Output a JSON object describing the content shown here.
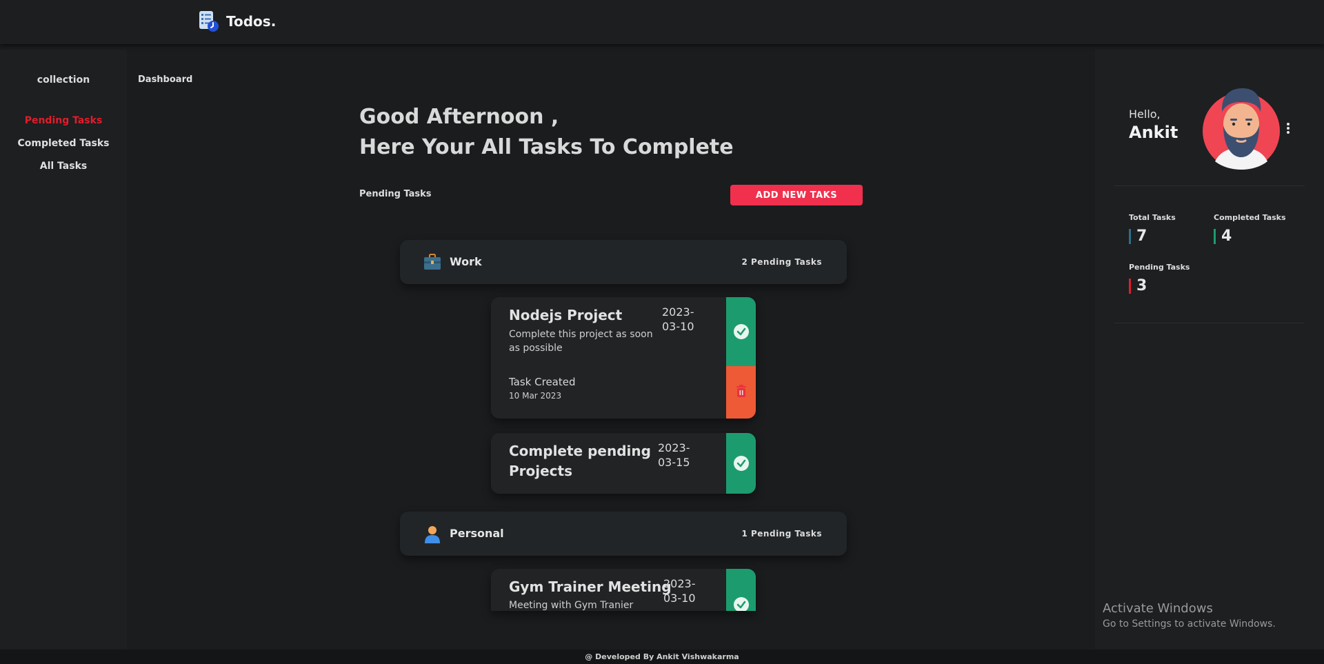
{
  "header": {
    "app_name": "Todos."
  },
  "sidebar": {
    "title": "collection",
    "items": [
      {
        "label": "Pending Tasks",
        "active": true
      },
      {
        "label": "Completed Tasks",
        "active": false
      },
      {
        "label": "All Tasks",
        "active": false
      }
    ]
  },
  "main": {
    "breadcrumb": "Dashboard",
    "greeting_line1": "Good Afternoon ,",
    "greeting_line2": "Here Your All Tasks To Complete",
    "section_label": "Pending Tasks",
    "add_button": "ADD NEW TAKS",
    "categories": [
      {
        "name": "Work",
        "count_label": "2 Pending Tasks",
        "icon": "briefcase-icon",
        "tasks": [
          {
            "title": "Nodejs Project",
            "description": "Complete this project as soon as possible",
            "date_line1": "2023-",
            "date_line2": "03-10",
            "created_label": "Task Created",
            "created_date": "10 Mar 2023"
          },
          {
            "title_line1": "Complete pending",
            "title_line2": "Projects",
            "date_line1": "2023-",
            "date_line2": "03-15"
          }
        ]
      },
      {
        "name": "Personal",
        "count_label": "1 Pending Tasks",
        "icon": "person-icon",
        "tasks": [
          {
            "title": "Gym Trainer Meeting",
            "description": "Meeting with Gym Tranier",
            "date_line1": "2023-",
            "date_line2": "03-10"
          }
        ]
      }
    ]
  },
  "profile": {
    "hello": "Hello,",
    "name": "Ankit",
    "stats": {
      "total": {
        "label": "Total Tasks",
        "value": "7",
        "color": "#2b6f8a"
      },
      "completed": {
        "label": "Completed Tasks",
        "value": "4",
        "color": "#1c9c6e"
      },
      "pending": {
        "label": "Pending Tasks",
        "value": "3",
        "color": "#e11d2b"
      }
    }
  },
  "watermark": {
    "line1": "Activate Windows",
    "line2": "Go to Settings to activate Windows."
  },
  "footer": {
    "text": "@ Developed By Ankit Vishwakarma"
  },
  "colors": {
    "accent": "#f0304d",
    "success": "#1c9c6e",
    "danger": "#ee5a35"
  }
}
